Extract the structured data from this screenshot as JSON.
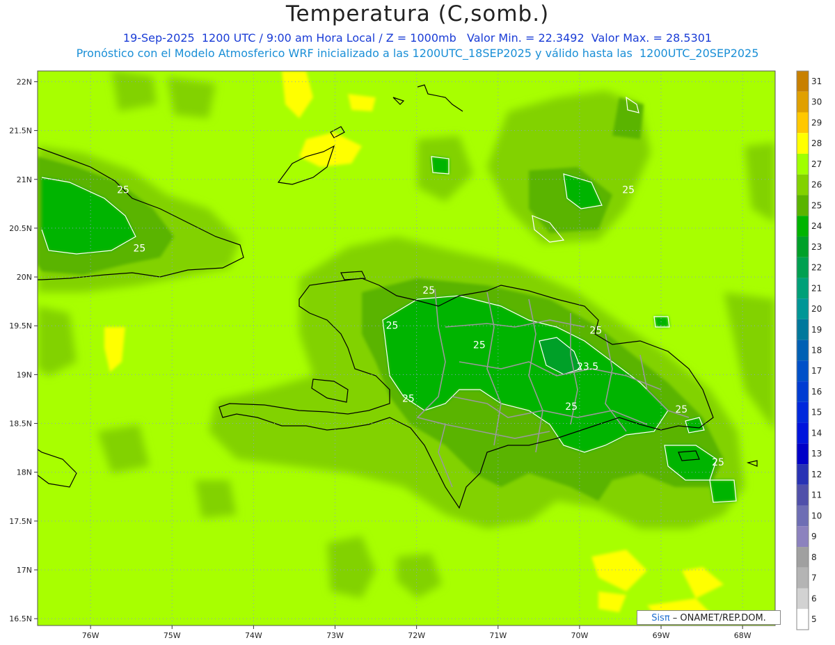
{
  "title": "Temperatura (C,somb.)",
  "subtitle_line1": "19-Sep-2025  1200 UTC / 9:00 am Hora Local / Z = 1000mb   Valor Min. = 22.3492  Valor Max. = 28.5301",
  "subtitle_line2": "Pronóstico con el Modelo Atmosferico WRF inicializado a las 1200UTC_18SEP2025 y válido hasta las  1200UTC_20SEP2025",
  "credit": {
    "brand": "Sisπ",
    "rest": " – ONAMET/REP.DOM."
  },
  "lat_labels": [
    "22N",
    "21.5N",
    "21N",
    "20.5N",
    "20N",
    "19.5N",
    "19N",
    "18.5N",
    "18N",
    "17.5N",
    "17N",
    "16.5N"
  ],
  "lon_labels": [
    "76W",
    "75W",
    "74W",
    "73W",
    "72W",
    "71W",
    "70W",
    "69W",
    "68W"
  ],
  "colorbar": {
    "labels": [
      "31",
      "30",
      "29",
      "28",
      "27",
      "26",
      "25",
      "24",
      "23",
      "22",
      "21",
      "20",
      "19",
      "18",
      "17",
      "16",
      "15",
      "14",
      "13",
      "12",
      "11",
      "10",
      "9",
      "8",
      "7",
      "6",
      "5"
    ],
    "colors": [
      "#c88000",
      "#e0a000",
      "#ffc800",
      "#ffff00",
      "#a0ff00",
      "#82d200",
      "#5ab400",
      "#00b400",
      "#00a028",
      "#00a050",
      "#00a078",
      "#009696",
      "#00789c",
      "#0060b4",
      "#0050c8",
      "#003cd2",
      "#0028dc",
      "#0014dc",
      "#0000c8",
      "#2832b4",
      "#5050aa",
      "#6e6eb4",
      "#8c82be",
      "#a0a0a0",
      "#b4b4b4",
      "#d2d2d2",
      "#ffffff"
    ]
  },
  "contour_labels": [
    {
      "text": "25",
      "lon": -75.6,
      "lat": 20.86
    },
    {
      "text": "25",
      "lon": -75.4,
      "lat": 20.26
    },
    {
      "text": "25",
      "lon": -71.85,
      "lat": 19.83
    },
    {
      "text": "25",
      "lon": -72.3,
      "lat": 19.47
    },
    {
      "text": "25",
      "lon": -71.23,
      "lat": 19.27
    },
    {
      "text": "25",
      "lon": -69.8,
      "lat": 19.42
    },
    {
      "text": "23.5",
      "lon": -69.9,
      "lat": 19.05
    },
    {
      "text": "25",
      "lon": -72.1,
      "lat": 18.72
    },
    {
      "text": "25",
      "lon": -70.1,
      "lat": 18.64
    },
    {
      "text": "25",
      "lon": -68.75,
      "lat": 18.61
    },
    {
      "text": "25",
      "lon": -68.3,
      "lat": 18.07
    },
    {
      "text": "25",
      "lon": -69.4,
      "lat": 20.86
    }
  ]
}
